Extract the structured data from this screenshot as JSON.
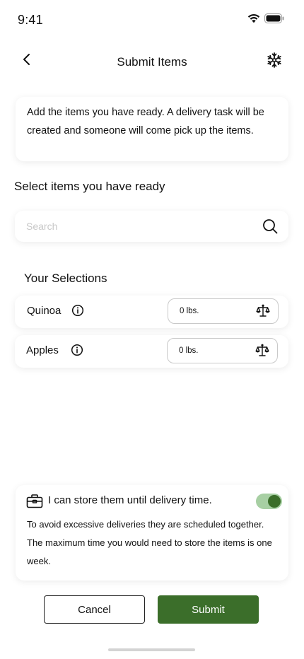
{
  "status_bar": {
    "time": "9:41",
    "icons": [
      "wifi-icon",
      "battery-icon"
    ]
  },
  "header": {
    "title": "Submit Items",
    "back_icon": "chevron-left-icon",
    "action_icon": "snowflake-icon"
  },
  "info_card": {
    "text": "Add the items you have ready. A delivery task will be created and someone will come pick up the items."
  },
  "select_heading": "Select items you have ready",
  "search": {
    "placeholder": "Search",
    "value": "",
    "icon": "search-icon"
  },
  "selections": {
    "heading": "Your Selections",
    "items": [
      {
        "name": "Quinoa",
        "weight": "0 lbs.",
        "info_icon": "info-icon",
        "weight_icon": "scale-icon"
      },
      {
        "name": "Apples",
        "weight": "0 lbs.",
        "info_icon": "info-icon",
        "weight_icon": "scale-icon"
      }
    ]
  },
  "storage": {
    "icon": "toolbox-icon",
    "title": "I can store them until delivery time.",
    "toggle_on": true,
    "description": "To avoid excessive deliveries they are scheduled together. The maximum time you would need to store the items is one week."
  },
  "actions": {
    "cancel_label": "Cancel",
    "submit_label": "Submit"
  },
  "colors": {
    "primary": "#3b6e2a",
    "toggle_track": "#a7cfa3",
    "placeholder": "#c8c8c8"
  }
}
